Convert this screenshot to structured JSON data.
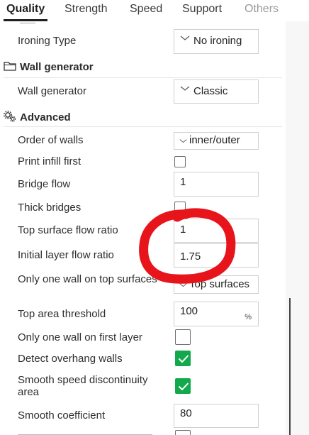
{
  "tabs": [
    {
      "label": "Quality",
      "state": "active"
    },
    {
      "label": "Strength",
      "state": "normal"
    },
    {
      "label": "Speed",
      "state": "normal"
    },
    {
      "label": "Support",
      "state": "normal"
    },
    {
      "label": "Others",
      "state": "disabled"
    }
  ],
  "rows": {
    "ironing_type": {
      "label": "Ironing Type",
      "value": "No ironing"
    },
    "wall_gen_section": {
      "title": "Wall generator",
      "icon": "folder-icon"
    },
    "wall_generator": {
      "label": "Wall generator",
      "value": "Classic"
    },
    "advanced_section": {
      "title": "Advanced",
      "icon": "gears-icon"
    },
    "order_of_walls": {
      "label": "Order of walls",
      "value": "inner/outer"
    },
    "print_infill_first": {
      "label": "Print infill first",
      "checked": false
    },
    "bridge_flow": {
      "label": "Bridge flow",
      "value": "1"
    },
    "thick_bridges": {
      "label": "Thick bridges",
      "checked": false
    },
    "top_surface_flow": {
      "label": "Top surface flow ratio",
      "value": "1"
    },
    "initial_layer_flow": {
      "label": "Initial layer flow ratio",
      "value": "1.75"
    },
    "one_wall_top": {
      "label": "Only one wall on top surfaces",
      "value": "Top surfaces"
    },
    "top_area_threshold": {
      "label": "Top area threshold",
      "value": "100",
      "unit": "%"
    },
    "one_wall_first": {
      "label": "Only one wall on first layer",
      "checked": false
    },
    "detect_overhang": {
      "label": "Detect overhang walls",
      "checked": true
    },
    "smooth_speed": {
      "label": "Smooth speed discontinuity area",
      "checked": true
    },
    "smooth_coeff": {
      "label": "Smooth coefficient",
      "value": "80"
    }
  },
  "colors": {
    "check_on": "#12a84c",
    "annotation": "#e8141b"
  }
}
